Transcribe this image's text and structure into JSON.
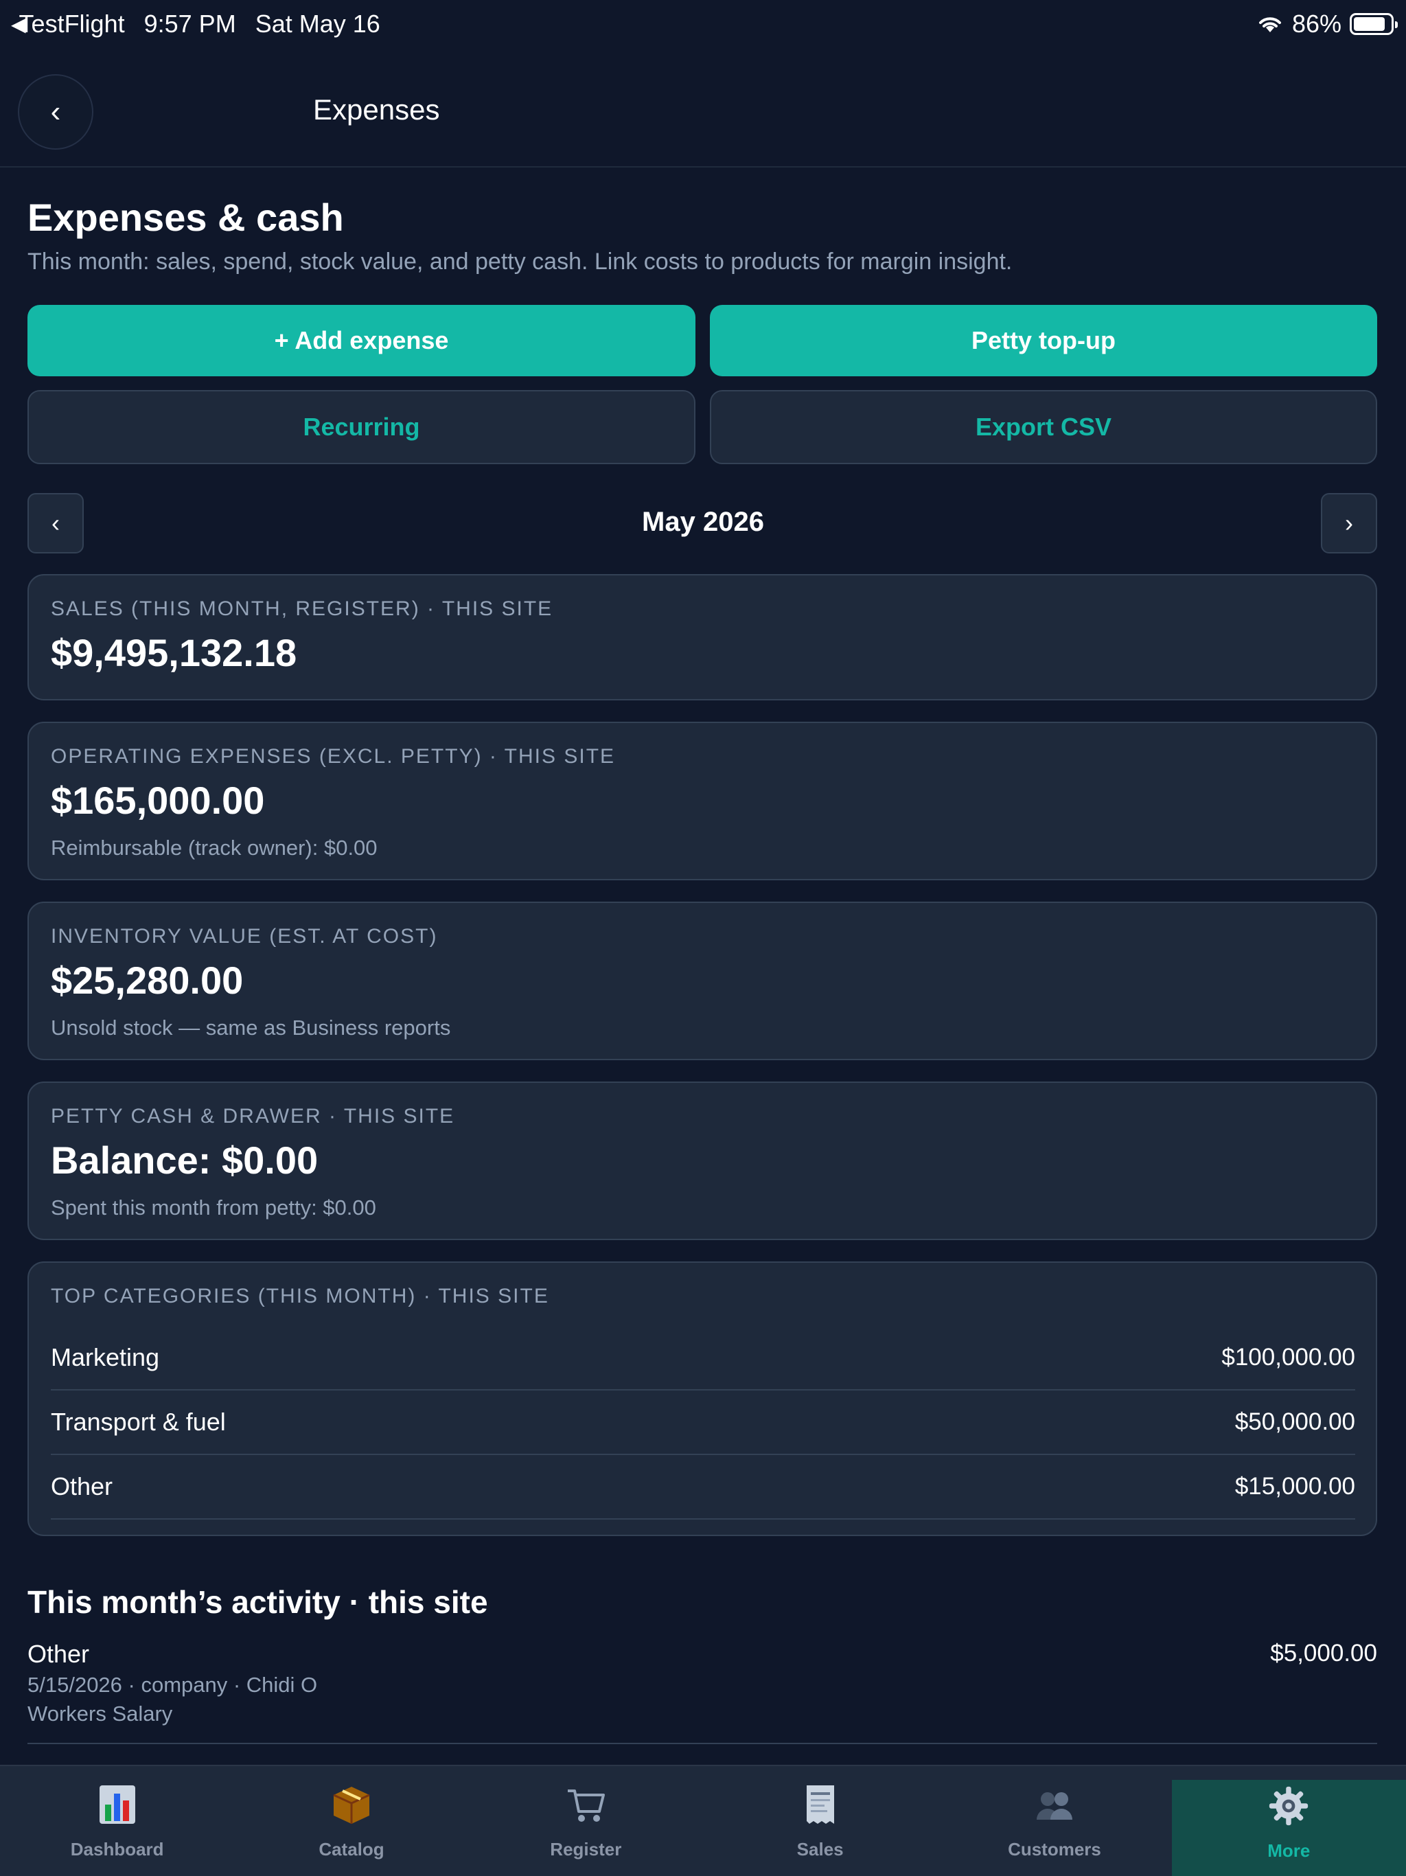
{
  "status_bar": {
    "back_app": "TestFlight",
    "time": "9:57 PM",
    "date": "Sat May 16",
    "battery": "86%"
  },
  "nav": {
    "title": "Expenses",
    "back_icon": "chevron-left-icon"
  },
  "header": {
    "title": "Expenses & cash",
    "subtitle": "This month: sales, spend, stock value, and petty cash. Link costs to products for margin insight."
  },
  "actions": {
    "add_expense": "+ Add expense",
    "petty_topup": "Petty top-up",
    "recurring": "Recurring",
    "export_csv": "Export CSV"
  },
  "month": {
    "label": "May 2026",
    "prev": "‹",
    "next": "›"
  },
  "cards": {
    "sales": {
      "label": "SALES (THIS MONTH, REGISTER) · THIS SITE",
      "value": "$9,495,132.18"
    },
    "opex": {
      "label": "OPERATING EXPENSES (EXCL. PETTY) · THIS SITE",
      "value": "$165,000.00",
      "note": "Reimbursable (track owner): $0.00"
    },
    "inventory": {
      "label": "INVENTORY VALUE (EST. AT COST)",
      "value": "$25,280.00",
      "note": "Unsold stock — same as Business reports"
    },
    "petty": {
      "label": "PETTY CASH & DRAWER · THIS SITE",
      "value": "Balance: $0.00",
      "note": "Spent this month from petty: $0.00"
    },
    "categories": {
      "label": "TOP CATEGORIES (THIS MONTH) · THIS SITE",
      "rows": [
        {
          "name": "Marketing",
          "amount": "$100,000.00"
        },
        {
          "name": "Transport & fuel",
          "amount": "$50,000.00"
        },
        {
          "name": "Other",
          "amount": "$15,000.00"
        }
      ]
    }
  },
  "activity": {
    "title": "This month’s activity · this site",
    "items": [
      {
        "title": "Other",
        "amount": "$5,000.00",
        "meta": "5/15/2026 · company · Chidi O",
        "desc": "Workers Salary"
      }
    ]
  },
  "tabs": [
    {
      "label": "Dashboard",
      "icon": "bar-chart-icon"
    },
    {
      "label": "Catalog",
      "icon": "package-icon"
    },
    {
      "label": "Register",
      "icon": "cart-icon"
    },
    {
      "label": "Sales",
      "icon": "receipt-icon"
    },
    {
      "label": "Customers",
      "icon": "people-icon"
    },
    {
      "label": "More",
      "icon": "gear-icon",
      "active": true
    }
  ],
  "colors": {
    "accent": "#14b8a6",
    "background": "#0f172a",
    "card": "#1e293b",
    "border": "#334155",
    "muted": "#94a3b8"
  }
}
